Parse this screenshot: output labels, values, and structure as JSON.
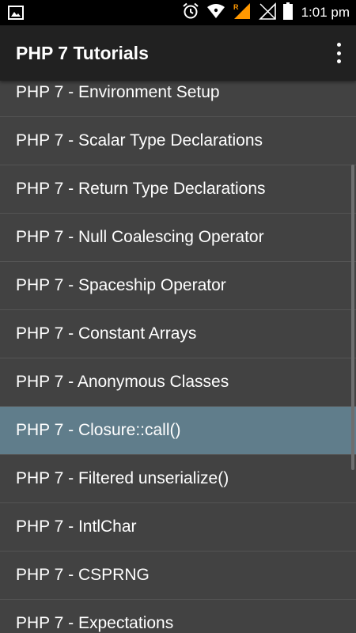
{
  "status_bar": {
    "time": "1:01 pm",
    "network_badge": "R",
    "icons": [
      "image-notification-icon",
      "alarm-icon",
      "wifi-icon",
      "signal-roaming-icon",
      "signal-empty-icon",
      "battery-icon"
    ]
  },
  "app_bar": {
    "title": "PHP 7 Tutorials",
    "overflow_icon": "more-vert-icon"
  },
  "list": {
    "selected_index": 7,
    "items": [
      {
        "label": "PHP 7 - Environment Setup"
      },
      {
        "label": "PHP 7 - Scalar Type Declarations"
      },
      {
        "label": "PHP 7 - Return Type Declarations"
      },
      {
        "label": "PHP 7 - Null Coalescing Operator"
      },
      {
        "label": "PHP 7 - Spaceship Operator"
      },
      {
        "label": "PHP 7 - Constant Arrays"
      },
      {
        "label": "PHP 7 - Anonymous Classes"
      },
      {
        "label": "PHP 7 - Closure::call()"
      },
      {
        "label": "PHP 7 - Filtered unserialize()"
      },
      {
        "label": "PHP 7 - IntlChar"
      },
      {
        "label": "PHP 7 - CSPRNG"
      },
      {
        "label": "PHP 7 - Expectations"
      }
    ]
  },
  "colors": {
    "status_bar": "#000000",
    "app_bar": "#212121",
    "list_background": "#424242",
    "selected_row": "#607d8b",
    "roaming_accent": "#ff9800"
  }
}
